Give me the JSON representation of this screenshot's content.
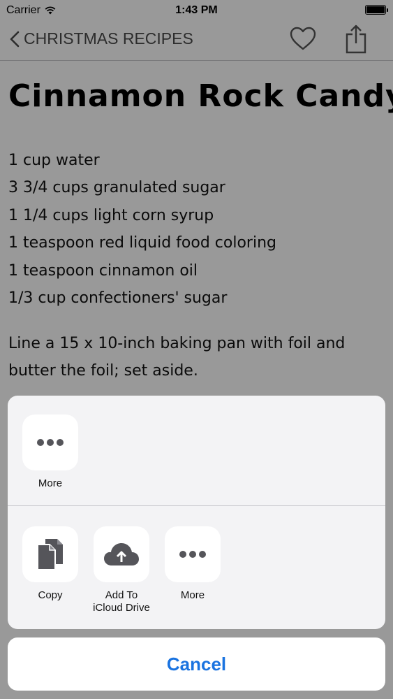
{
  "status_bar": {
    "carrier": "Carrier",
    "time": "1:43 PM"
  },
  "nav": {
    "back_label": "CHRISTMAS RECIPES"
  },
  "recipe": {
    "title": "Cinnamon Rock Candy",
    "ingredients": [
      "1 cup water",
      "3 3/4 cups granulated sugar",
      "1 1/4 cups light corn syrup",
      "1 teaspoon red liquid food coloring",
      "1 teaspoon cinnamon oil",
      "1/3 cup confectioners' sugar"
    ],
    "instructions": "Line a 15 x 10-inch baking pan with foil and butter the foil; set aside."
  },
  "share_sheet": {
    "share_row": [
      {
        "label": "More",
        "icon": "more-icon"
      }
    ],
    "action_row": [
      {
        "label": "Copy",
        "icon": "copy-icon"
      },
      {
        "label": "Add To iCloud Drive",
        "icon": "icloud-upload-icon"
      },
      {
        "label": "More",
        "icon": "more-icon"
      }
    ],
    "cancel_label": "Cancel"
  },
  "colors": {
    "accent": "#1a73e0",
    "icon_gray": "#55555a",
    "nav_gray": "#4a4a4a"
  }
}
